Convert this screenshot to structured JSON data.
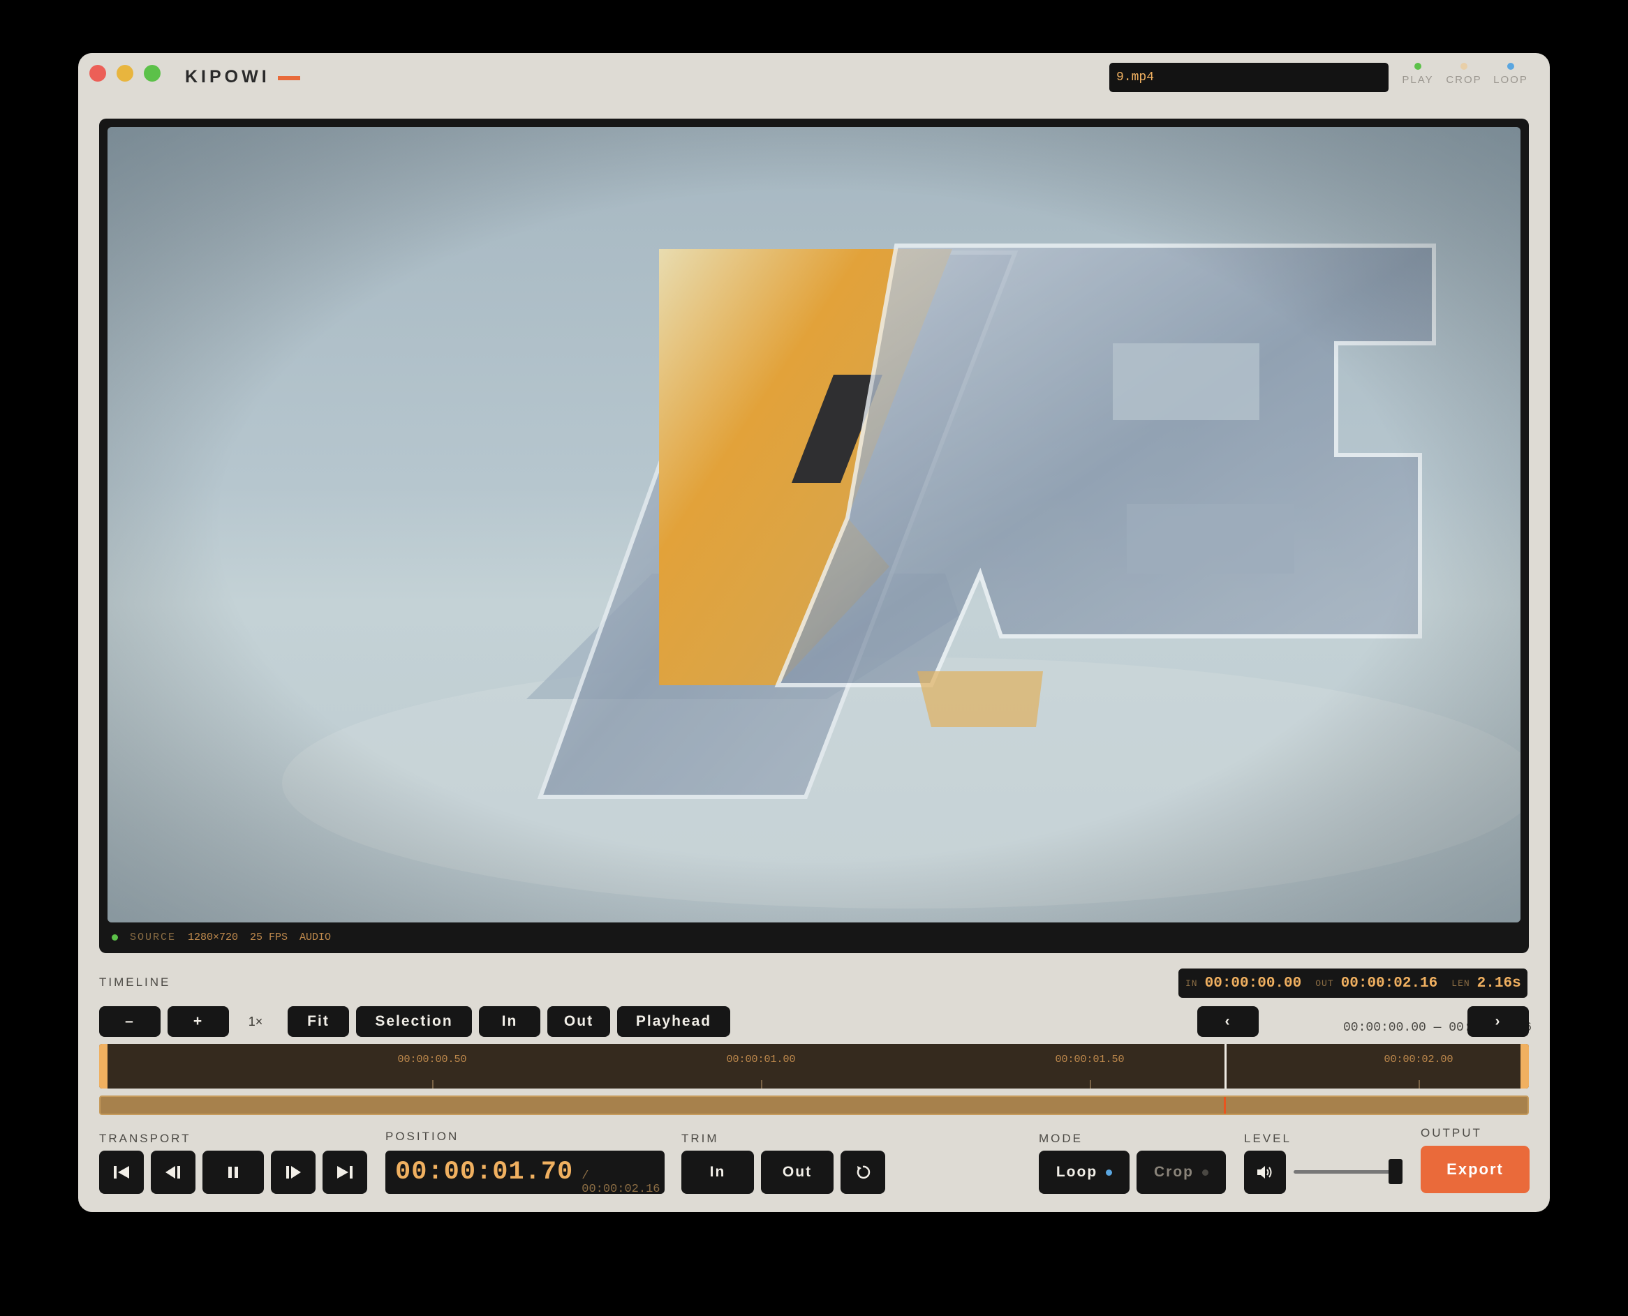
{
  "app": {
    "name": "KIPOWI"
  },
  "file": {
    "name": "9.mp4"
  },
  "indicators": [
    {
      "label": "PLAY",
      "color": "#5cc149"
    },
    {
      "label": "CROP",
      "color": "#e8cfa8"
    },
    {
      "label": "LOOP",
      "color": "#5aa6e0"
    }
  ],
  "viewer": {
    "status": {
      "source": "SOURCE",
      "resolution": "1280×720",
      "fps": "25 FPS",
      "audio": "AUDIO"
    }
  },
  "timeline": {
    "label": "TIMELINE",
    "in_key": "IN",
    "in_value": "00:00:00.00",
    "out_key": "OUT",
    "out_value": "00:00:02.16",
    "len_key": "LEN",
    "len_value": "2.16s",
    "zoom_out": "–",
    "zoom_in": "+",
    "zoom_level": "1×",
    "fit": "Fit",
    "selection": "Selection",
    "in": "In",
    "out": "Out",
    "playhead": "Playhead",
    "prev": "‹",
    "next": "›",
    "range_text": "00:00:00.00 — 00:00:02.16",
    "ticks": [
      "00:00:00.50",
      "00:00:01.00",
      "00:00:01.50",
      "00:00:02.00"
    ],
    "playhead_fraction": 0.787
  },
  "transport": {
    "label": "TRANSPORT"
  },
  "position": {
    "label": "POSITION",
    "current": "00:00:01.70",
    "total": "/ 00:00:02.16"
  },
  "trim": {
    "label": "TRIM",
    "in": "In",
    "out": "Out"
  },
  "mode": {
    "label": "MODE",
    "loop": "Loop",
    "crop": "Crop",
    "loop_dot": "#5aa6e0",
    "crop_dot": "#4a4843"
  },
  "level": {
    "label": "LEVEL",
    "value_fraction": 0.95
  },
  "output": {
    "label": "OUTPUT",
    "export": "Export"
  }
}
